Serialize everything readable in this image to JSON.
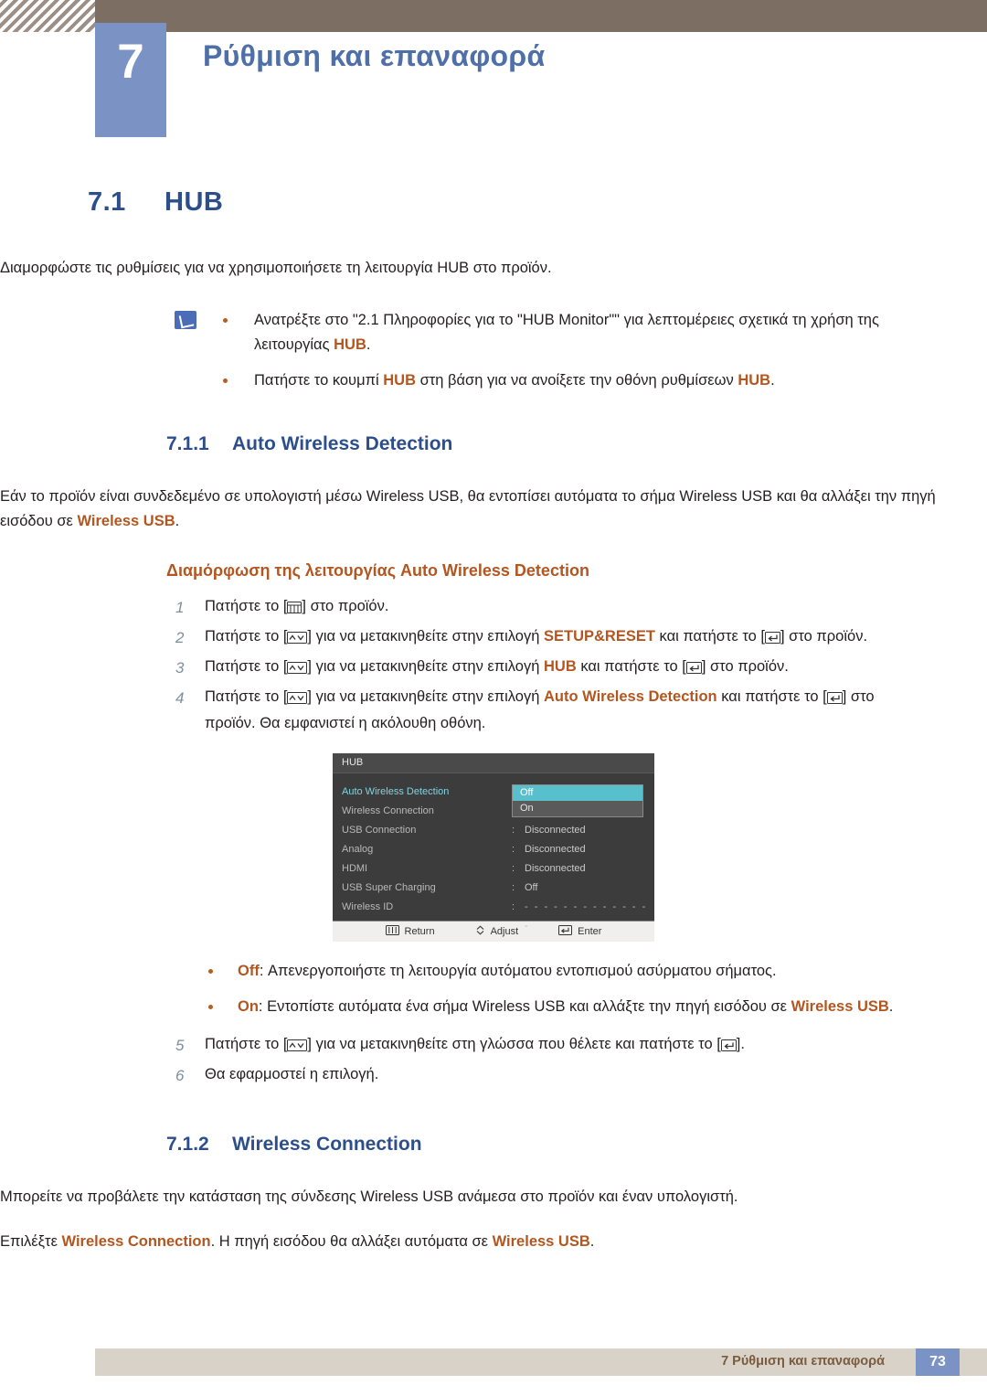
{
  "header": {
    "chapter_number": "7",
    "chapter_title": "Ρύθμιση και επαναφορά"
  },
  "section": {
    "number": "7.1",
    "title": "HUB",
    "intro": "Διαμορφώστε τις ρυθμίσεις για να χρησιμοποιήσετε τη λειτουργία HUB στο προϊόν."
  },
  "note": {
    "bullets": [
      "Ανατρέξτε στο \"2.1 Πληροφορίες για το \"HUB Monitor\"\" για λεπτομέρειες σχετικά τη χρήση της λειτουργίας HUB.",
      "Πατήστε το κουμπί HUB στη βάση για να ανοίξετε την οθόνη ρυθμίσεων HUB."
    ]
  },
  "sub1": {
    "number": "7.1.1",
    "title": "Auto Wireless Detection",
    "paragraph": "Εάν το προϊόν είναι συνδεδεμένο σε υπολογιστή μέσω Wireless USB, θα εντοπίσει αυτόματα το σήμα Wireless USB και θα αλλάξει την πηγή εισόδου σε Wireless USB.",
    "orange_heading": "Διαμόρφωση της λειτουργίας Auto Wireless Detection",
    "steps": [
      "Πατήστε το [ ] στο προϊόν.",
      "Πατήστε το [ ] για να μετακινηθείτε στην επιλογή SETUP&RESET και πατήστε το [ ] στο προϊόν.",
      "Πατήστε το [ ] για να μετακινηθείτε στην επιλογή HUB και πατήστε το [ ] στο προϊόν.",
      "Πατήστε το [ ] για να μετακινηθείτε στην επιλογή Auto Wireless Detection και πατήστε το [ ] στο προϊόν. Θα εμφανιστεί η ακόλουθη οθόνη.",
      "Πατήστε το [ ] για να μετακινηθείτε στη γλώσσα που θέλετε και πατήστε το [ ].",
      "Θα εφαρμοστεί η επιλογή."
    ],
    "options": [
      "Off: Απενεργοποιήστε τη λειτουργία αυτόματου εντοπισμού ασύρματου σήματος.",
      "On: Εντοπίστε αυτόματα ένα σήμα Wireless USB και αλλάξτε την πηγή εισόδου σε Wireless USB."
    ]
  },
  "osd": {
    "title": "HUB",
    "rows": [
      {
        "label": "Auto Wireless Detection",
        "value": "",
        "selected": true
      },
      {
        "label": "Wireless Connection",
        "value": "",
        "selected": false
      },
      {
        "label": "USB Connection",
        "value": "Disconnected",
        "selected": false
      },
      {
        "label": "Analog",
        "value": "Disconnected",
        "selected": false
      },
      {
        "label": "HDMI",
        "value": "Disconnected",
        "selected": false
      },
      {
        "label": "USB Super Charging",
        "value": "Off",
        "selected": false
      },
      {
        "label": "Wireless ID",
        "value": "- - - - - - - - - - - - - -",
        "selected": false
      }
    ],
    "dropdown": {
      "options": [
        "Off",
        "On"
      ],
      "highlighted": "Off"
    },
    "footer": {
      "return": "Return",
      "adjust": "Adjust",
      "enter": "Enter"
    }
  },
  "sub2": {
    "number": "7.1.2",
    "title": "Wireless Connection",
    "paragraph": "Μπορείτε να προβάλετε την κατάσταση της σύνδεσης Wireless USB ανάμεσα στο προϊόν και έναν υπολογιστή.",
    "paragraph2": "Επιλέξτε Wireless Connection. Η πηγή εισόδου θα αλλάξει αυτόματα σε Wireless USB."
  },
  "footer": {
    "text": "7 Ρύθμιση και επαναφορά",
    "page": "73"
  },
  "colors": {
    "heading_blue": "#2c4f8c",
    "accent_orange": "#b3561f",
    "chapter_box": "#7b93c4",
    "header_bar": "#7d6e63",
    "footer_bar": "#d9d2c9",
    "osd_highlight": "#58c0cc"
  }
}
